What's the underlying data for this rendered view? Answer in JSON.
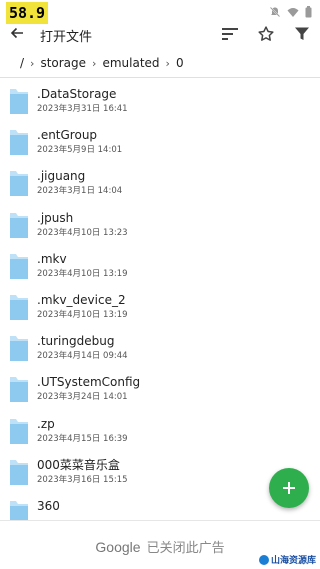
{
  "status": {
    "fps": "58.9"
  },
  "appbar": {
    "title": "打开文件"
  },
  "breadcrumb": [
    "/",
    "storage",
    "emulated",
    "0"
  ],
  "files": [
    {
      "name": ".DataStorage",
      "date": "2023年3月31日 16:41"
    },
    {
      "name": ".entGroup",
      "date": "2023年5月9日 14:01"
    },
    {
      "name": ".jiguang",
      "date": "2023年3月1日 14:04"
    },
    {
      "name": ".jpush",
      "date": "2023年4月10日 13:23"
    },
    {
      "name": ".mkv",
      "date": "2023年4月10日 13:19"
    },
    {
      "name": ".mkv_device_2",
      "date": "2023年4月10日 13:19"
    },
    {
      "name": ".turingdebug",
      "date": "2023年4月14日 09:44"
    },
    {
      "name": ".UTSystemConfig",
      "date": "2023年3月24日 14:01"
    },
    {
      "name": ".zp",
      "date": "2023年4月15日 16:39"
    },
    {
      "name": "000菜菜音乐盒",
      "date": "2023年3月16日 15:15"
    },
    {
      "name": "360",
      "date": ""
    }
  ],
  "ad": {
    "brand": "Google",
    "text": "已关闭此广告"
  },
  "watermark": {
    "text": "山海资源库"
  },
  "colors": {
    "accent": "#2eae4d",
    "folder": "#8ec9ef",
    "fps_badge": "#f2e33a"
  }
}
